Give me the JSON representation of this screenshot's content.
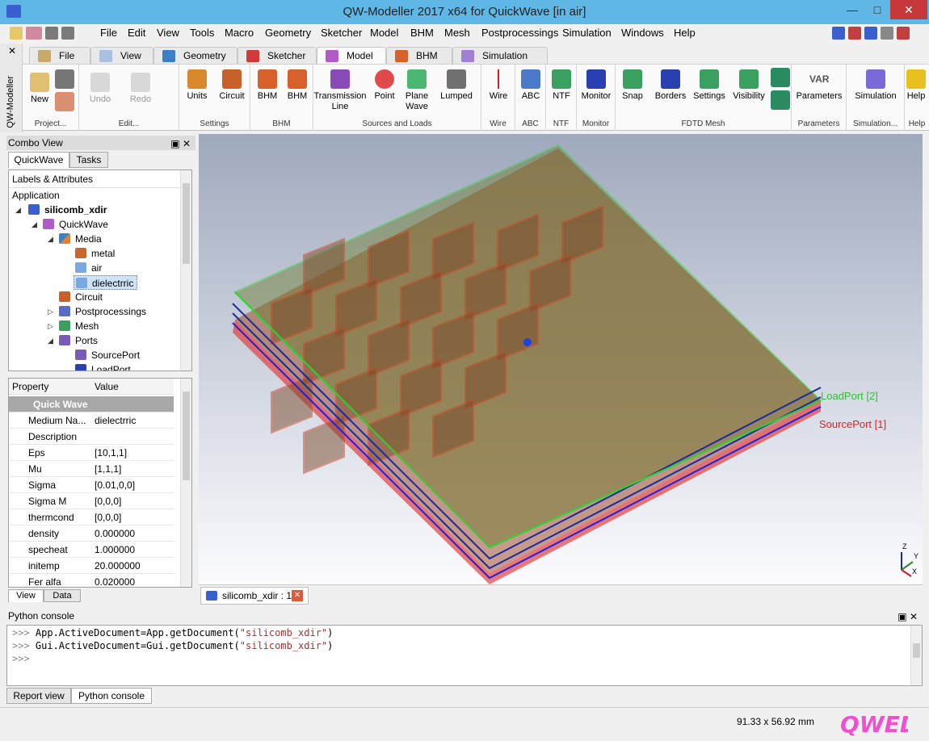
{
  "window": {
    "title": "QW-Modeller 2017 x64 for QuickWave [in air]"
  },
  "menu": [
    "File",
    "Edit",
    "View",
    "Tools",
    "Macro",
    "Geometry",
    "Sketcher",
    "Model",
    "BHM",
    "Mesh",
    "Postprocessings",
    "Simulation",
    "Windows",
    "Help"
  ],
  "side_strip": {
    "label": "QW-Modeller"
  },
  "ribbon_tabs": [
    "File",
    "View",
    "Geometry",
    "Sketcher",
    "Model",
    "BHM",
    "Simulation"
  ],
  "ribbon": {
    "project": {
      "label": "Project...",
      "new": "New"
    },
    "edit": {
      "label": "Edit...",
      "undo": "Undo",
      "redo": "Redo"
    },
    "settings": {
      "label": "Settings",
      "units": "Units",
      "circuit": "Circuit"
    },
    "bhm": {
      "label": "BHM",
      "bhm_menu": "BHM",
      "bhm": "BHM"
    },
    "sources": {
      "label": "Sources and Loads",
      "tline1": "Transmission",
      "tline2": "Line",
      "point": "Point",
      "plane1": "Plane",
      "plane2": "Wave",
      "lumped": "Lumped"
    },
    "wire": {
      "label": "Wire",
      "wire": "Wire"
    },
    "abc": {
      "label": "ABC",
      "abc": "ABC"
    },
    "ntf": {
      "label": "NTF",
      "ntf": "NTF"
    },
    "monitor": {
      "label": "Monitor",
      "monitor": "Monitor"
    },
    "fdtd": {
      "label": "FDTD Mesh",
      "snap": "Snap",
      "borders": "Borders",
      "settings": "Settings",
      "visibility": "Visibility"
    },
    "parameters": {
      "label": "Parameters",
      "parameters": "Parameters",
      "var": "VAR"
    },
    "simulation": {
      "label": "Simulation...",
      "simulation": "Simulation"
    },
    "help": {
      "label": "Help",
      "help": "Help"
    }
  },
  "combo": {
    "title": "Combo View",
    "tabs": [
      "QuickWave",
      "Tasks"
    ],
    "tree_header": "Labels & Attributes",
    "tree": [
      {
        "label": "Application",
        "indent": 0
      },
      {
        "label": "silicomb_xdir",
        "indent": 1
      },
      {
        "label": "QuickWave",
        "indent": 2
      },
      {
        "label": "Media",
        "indent": 3
      },
      {
        "label": "metal",
        "indent": 4
      },
      {
        "label": "air",
        "indent": 4
      },
      {
        "label": "dielectrric",
        "indent": 4
      },
      {
        "label": "Circuit",
        "indent": 3
      },
      {
        "label": "Postprocessings",
        "indent": 3
      },
      {
        "label": "Mesh",
        "indent": 3
      },
      {
        "label": "Ports",
        "indent": 3
      },
      {
        "label": "SourcePort",
        "indent": 4
      },
      {
        "label": "LoadPort",
        "indent": 4
      }
    ],
    "props_header": [
      "Property",
      "Value"
    ],
    "props_group": "Quick Wave",
    "props": [
      [
        "Medium Na...",
        "dielectrric"
      ],
      [
        "Description",
        ""
      ],
      [
        "Eps",
        "[10,1,1]"
      ],
      [
        "Mu",
        "[1,1,1]"
      ],
      [
        "Sigma",
        "[0.01,0,0]"
      ],
      [
        "Sigma M",
        "[0,0,0]"
      ],
      [
        "thermcond",
        "[0,0,0]"
      ],
      [
        "density",
        "0.000000"
      ],
      [
        "specheat",
        "1.000000"
      ],
      [
        "initemp",
        "20.000000"
      ],
      [
        "Fer alfa",
        "0.020000"
      ]
    ],
    "bottom_tabs": [
      "View",
      "Data"
    ]
  },
  "viewport": {
    "load_port": "LoadPort [2]",
    "source_port": "SourcePort [1]",
    "axes": [
      "Z",
      "Y",
      "X"
    ]
  },
  "doc_tab": "silicomb_xdir : 1",
  "python": {
    "title": "Python console",
    "lines": [
      {
        "prompt": ">>> ",
        "code": "App.ActiveDocument=App.getDocument(",
        "str": "\"silicomb_xdir\"",
        "end": ")"
      },
      {
        "prompt": ">>> ",
        "code": "Gui.ActiveDocument=Gui.getDocument(",
        "str": "\"silicomb_xdir\"",
        "end": ")"
      },
      {
        "prompt": ">>> ",
        "code": "",
        "str": "",
        "end": ""
      }
    ]
  },
  "bottom_tabs": [
    "Report view",
    "Python console"
  ],
  "status": {
    "dims": "91.33 x 56.92 mm",
    "logo": "QWED"
  }
}
